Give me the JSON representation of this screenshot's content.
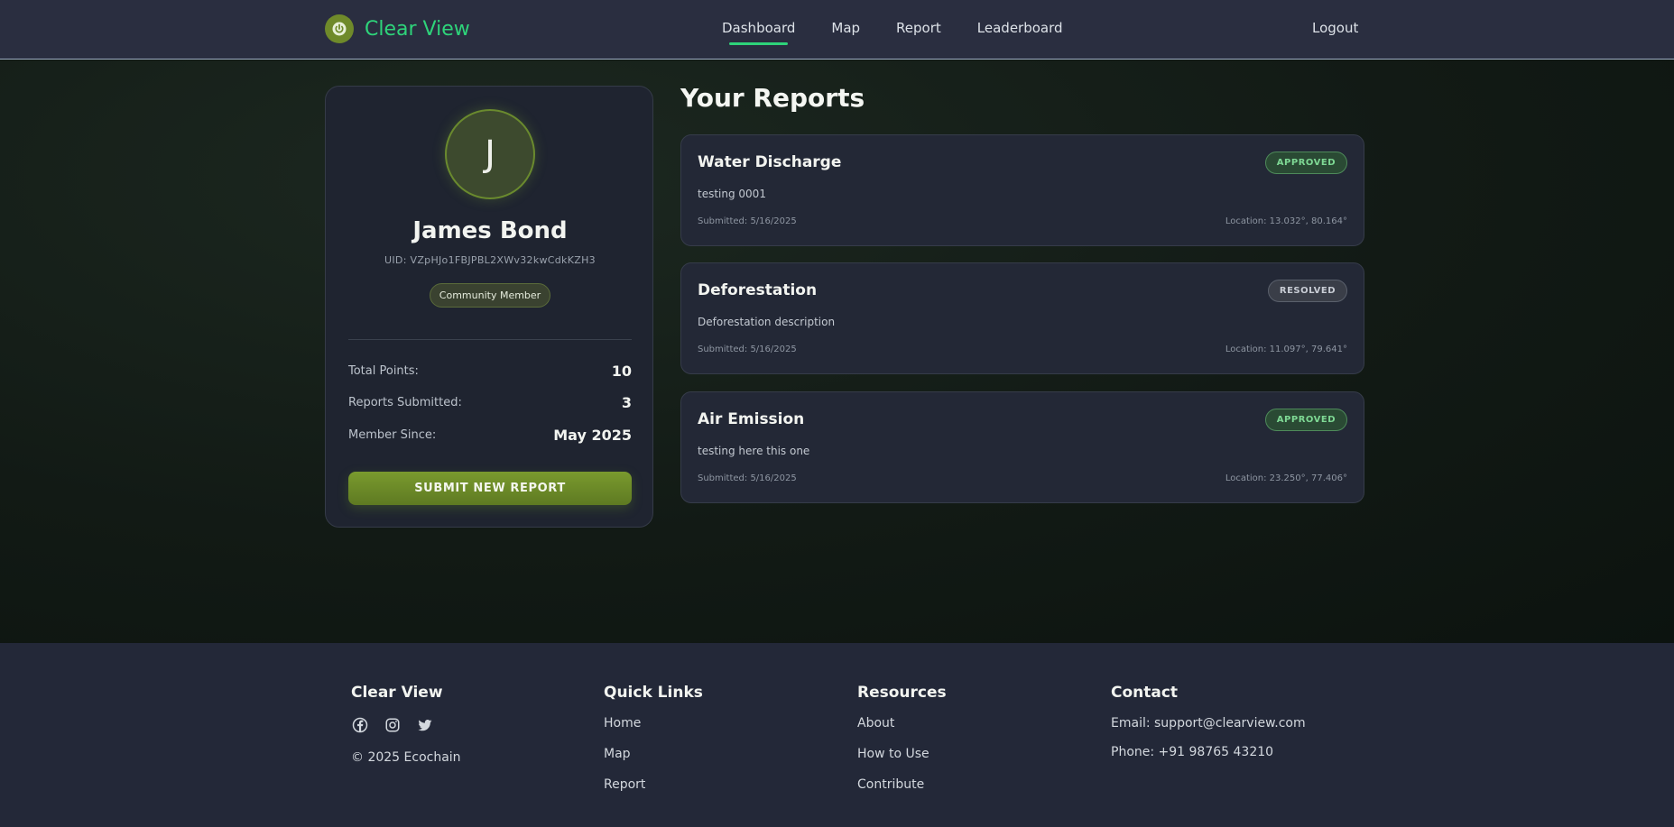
{
  "nav": {
    "brand": "Clear View",
    "links": [
      "Dashboard",
      "Map",
      "Report",
      "Leaderboard"
    ],
    "active": "Dashboard",
    "logout": "Logout",
    "accent_color": "#2ed47a"
  },
  "profile": {
    "initial": "J",
    "name": "James Bond",
    "uid": "UID: VZpHJo1FBJPBL2XWv32kwCdkKZH3",
    "badge": "Community Member",
    "stats": [
      {
        "label": "Total Points:",
        "value": "10"
      },
      {
        "label": "Reports Submitted:",
        "value": "3"
      },
      {
        "label": "Member Since:",
        "value": "May 2025"
      }
    ],
    "submit_label": "SUBMIT NEW REPORT"
  },
  "reports": {
    "title": "Your Reports",
    "items": [
      {
        "title": "Water Discharge",
        "status": "APPROVED",
        "description": "testing 0001",
        "submitted": "Submitted: 5/16/2025",
        "location": "Location: 13.032°, 80.164°"
      },
      {
        "title": "Deforestation",
        "status": "RESOLVED",
        "description": "Deforestation description",
        "submitted": "Submitted: 5/16/2025",
        "location": "Location: 11.097°, 79.641°"
      },
      {
        "title": "Air Emission",
        "status": "APPROVED",
        "description": "testing here this one",
        "submitted": "Submitted: 5/16/2025",
        "location": "Location: 23.250°, 77.406°"
      }
    ]
  },
  "footer": {
    "brand": "Clear View",
    "copyright": "© 2025 Ecochain",
    "social_icons": [
      "facebook-icon",
      "instagram-icon",
      "twitter-icon"
    ],
    "quick_links_heading": "Quick Links",
    "quick_links": [
      "Home",
      "Map",
      "Report"
    ],
    "resources_heading": "Resources",
    "resources": [
      "About",
      "How to Use",
      "Contribute"
    ],
    "contact_heading": "Contact",
    "email": "Email: support@clearview.com",
    "phone": "Phone: +91 98765 43210"
  }
}
